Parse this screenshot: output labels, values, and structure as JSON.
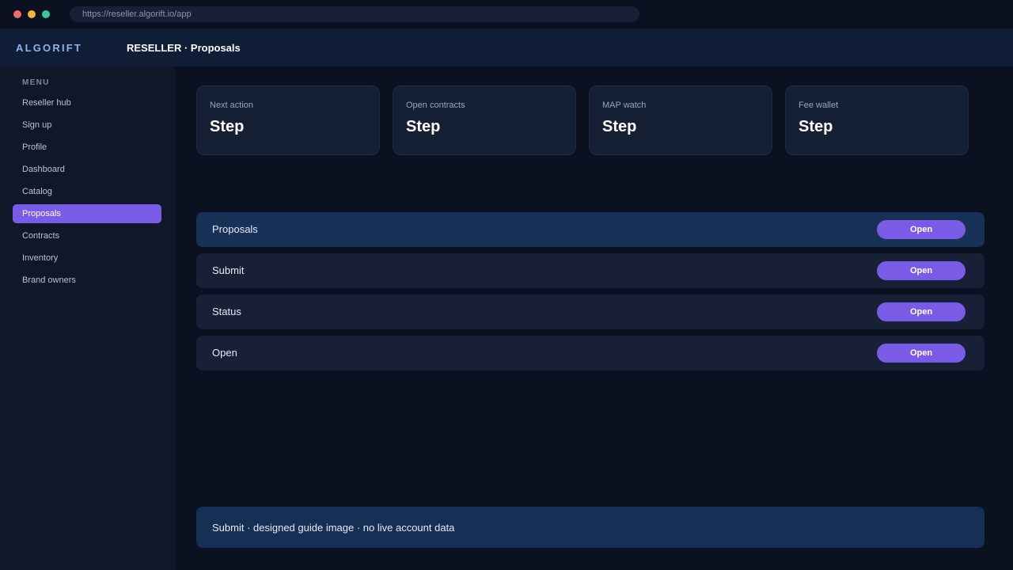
{
  "browser": {
    "url": "https://reseller.algorift.io/app"
  },
  "header": {
    "brand": "ALGORIFT",
    "title": "RESELLER · Proposals"
  },
  "sidebar": {
    "menu_label": "MENU",
    "items": [
      {
        "label": "Reseller hub"
      },
      {
        "label": "Sign up"
      },
      {
        "label": "Profile"
      },
      {
        "label": "Dashboard"
      },
      {
        "label": "Catalog"
      },
      {
        "label": "Proposals",
        "active": true
      },
      {
        "label": "Contracts"
      },
      {
        "label": "Inventory"
      },
      {
        "label": "Brand owners"
      }
    ]
  },
  "cards": [
    {
      "label": "Next action",
      "value": "Step"
    },
    {
      "label": "Open contracts",
      "value": "Step"
    },
    {
      "label": "MAP watch",
      "value": "Step"
    },
    {
      "label": "Fee wallet",
      "value": "Step"
    }
  ],
  "rows": [
    {
      "label": "Proposals",
      "button": "Open"
    },
    {
      "label": "Submit",
      "button": "Open"
    },
    {
      "label": "Status",
      "button": "Open"
    },
    {
      "label": "Open",
      "button": "Open"
    }
  ],
  "footer": {
    "text": "Submit · designed guide image · no live account data"
  },
  "colors": {
    "accent": "#7a5be6",
    "background": "#0b1120",
    "sidebar": "#0f1729",
    "header": "#0f1d36",
    "card": "#162035",
    "row_highlight": "#183257"
  }
}
